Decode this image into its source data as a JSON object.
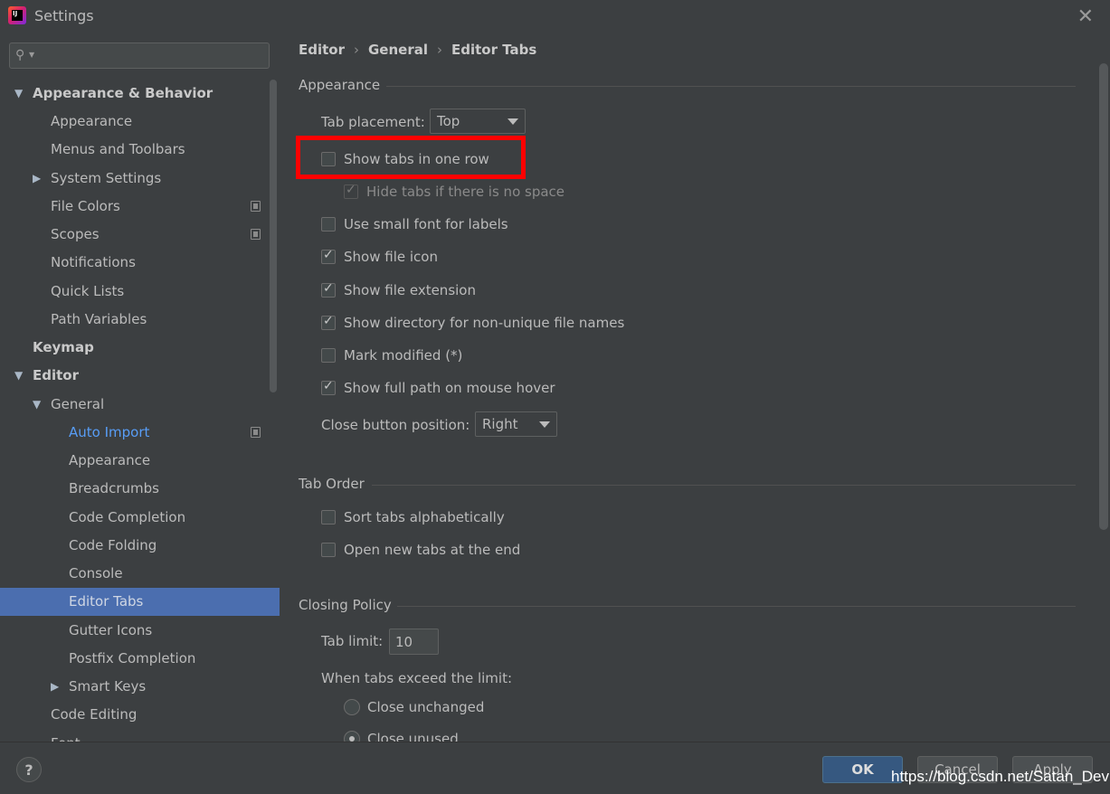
{
  "window": {
    "title": "Settings",
    "app_icon_text": "IJ"
  },
  "search": {
    "placeholder": "",
    "value": ""
  },
  "sidebar": {
    "items": [
      {
        "label": "Appearance & Behavior",
        "arrow": "▼"
      },
      {
        "label": "Appearance"
      },
      {
        "label": "Menus and Toolbars"
      },
      {
        "label": "System Settings",
        "arrow": "▶"
      },
      {
        "label": "File Colors"
      },
      {
        "label": "Scopes"
      },
      {
        "label": "Notifications"
      },
      {
        "label": "Quick Lists"
      },
      {
        "label": "Path Variables"
      },
      {
        "label": "Keymap"
      },
      {
        "label": "Editor",
        "arrow": "▼"
      },
      {
        "label": "General",
        "arrow": "▼"
      },
      {
        "label": "Auto Import"
      },
      {
        "label": "Appearance"
      },
      {
        "label": "Breadcrumbs"
      },
      {
        "label": "Code Completion"
      },
      {
        "label": "Code Folding"
      },
      {
        "label": "Console"
      },
      {
        "label": "Editor Tabs"
      },
      {
        "label": "Gutter Icons"
      },
      {
        "label": "Postfix Completion"
      },
      {
        "label": "Smart Keys",
        "arrow": "▶"
      },
      {
        "label": "Code Editing"
      },
      {
        "label": "Font"
      }
    ]
  },
  "breadcrumb": {
    "part1": "Editor",
    "part2": "General",
    "part3": "Editor Tabs",
    "separator": "›"
  },
  "appearance": {
    "heading": "Appearance",
    "tab_placement_label": "Tab placement:",
    "tab_placement_value": "Top",
    "show_tabs_one_row": {
      "label": "Show tabs in one row",
      "checked": false
    },
    "hide_tabs_no_space": {
      "label": "Hide tabs if there is no space",
      "checked": true,
      "disabled": true
    },
    "small_font": {
      "label": "Use small font for labels",
      "checked": false
    },
    "show_file_icon": {
      "label": "Show file icon",
      "checked": true
    },
    "show_file_extension": {
      "label": "Show file extension",
      "checked": true
    },
    "show_directory": {
      "label": "Show directory for non-unique file names",
      "checked": true
    },
    "mark_modified": {
      "label": "Mark modified (*)",
      "checked": false
    },
    "show_full_path": {
      "label": "Show full path on mouse hover",
      "checked": true
    },
    "close_button_label": "Close button position:",
    "close_button_value": "Right"
  },
  "tab_order": {
    "heading": "Tab Order",
    "sort_alpha": {
      "label": "Sort tabs alphabetically",
      "checked": false
    },
    "open_at_end": {
      "label": "Open new tabs at the end",
      "checked": false
    }
  },
  "closing_policy": {
    "heading": "Closing Policy",
    "tab_limit_label": "Tab limit:",
    "tab_limit_value": "10",
    "exceed_label": "When tabs exceed the limit:",
    "close_unchanged": {
      "label": "Close unchanged",
      "selected": false
    },
    "close_unused": {
      "label": "Close unused",
      "selected": true
    }
  },
  "footer": {
    "help": "?",
    "ok": "OK",
    "cancel": "Cancel",
    "apply": "Apply",
    "watermark": "https://blog.csdn.net/Satan_Devil"
  },
  "colors": {
    "accent": "#4b6eaf",
    "highlight": "#ff0000",
    "link": "#589df6",
    "background": "#3c3f41"
  }
}
